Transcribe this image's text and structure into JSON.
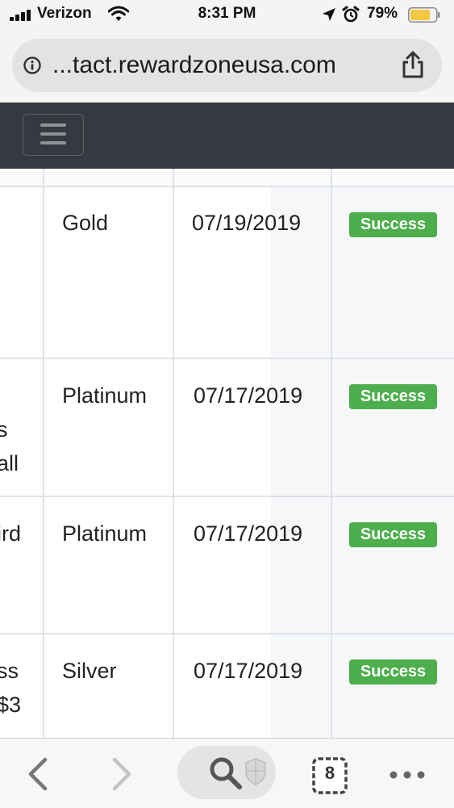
{
  "status_bar": {
    "carrier": "Verizon",
    "time": "8:31 PM",
    "battery_percent": "79%",
    "battery_fill": 0.79,
    "battery_color": "#f5c842"
  },
  "address_bar": {
    "url": "...tact.rewardzoneusa.com"
  },
  "table": {
    "rows": [
      {
        "col1_lines": [],
        "tier": "Gold",
        "date": "07/19/2019",
        "status": "Success"
      },
      {
        "col1_lines": [
          "s",
          "all"
        ],
        "tier": "Platinum",
        "date": "07/17/2019",
        "status": "Success"
      },
      {
        "col1_lines": [
          "ird"
        ],
        "tier": "Platinum",
        "date": "07/17/2019",
        "status": "Success"
      },
      {
        "col1_lines": [
          "ss",
          "$3"
        ],
        "tier": "Silver",
        "date": "07/17/2019",
        "status": "Success"
      }
    ],
    "status_color": "#4cae4c"
  },
  "toolbar": {
    "tab_count": "8"
  },
  "icons": {
    "status_bar": [
      "signal-icon",
      "wifi-icon",
      "location-arrow-icon",
      "alarm-clock-icon",
      "battery-icon"
    ],
    "address_bar": [
      "info-icon",
      "share-icon"
    ],
    "navbar": [
      "hamburger-icon"
    ],
    "toolbar": [
      "back-arrow-icon",
      "forward-arrow-icon",
      "search-icon",
      "shield-icon",
      "tabs-icon",
      "more-icon"
    ]
  }
}
